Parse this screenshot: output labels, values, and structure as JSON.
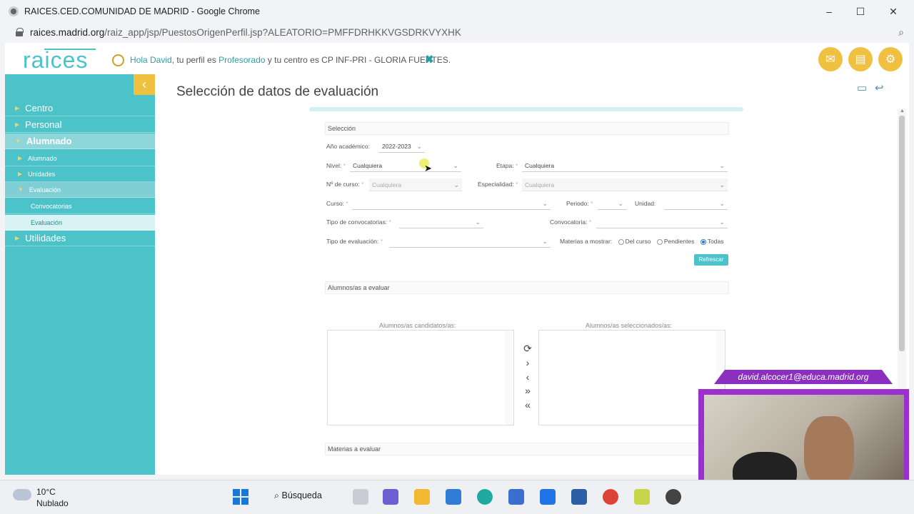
{
  "browser": {
    "window_title": "RAICES.CED.COMUNIDAD DE MADRID - Google Chrome",
    "url_domain": "raices.madrid.org",
    "url_path": "/raiz_app/jsp/PuestosOrigenPerfil.jsp?ALEATORIO=PMFFDRHKKVGSDRKVYXHK",
    "minimize": "–",
    "maximize": "☐",
    "close": "✕",
    "zoom_icon": "⌕"
  },
  "header": {
    "logo": "raices",
    "greeting_prefix": "Hola David",
    "greeting_mid1": ", tu perfil es ",
    "profile": "Profesorado",
    "greeting_mid2": " y tu centro es ",
    "centre": "CP INF-PRI - GLORIA FUERTES.",
    "close_mark": "✖",
    "icons": [
      "mail-icon",
      "documents-icon",
      "settings-icon"
    ]
  },
  "sidebar": {
    "collapse": "‹",
    "items": [
      {
        "label": "Centro"
      },
      {
        "label": "Personal"
      },
      {
        "label": "Alumnado"
      },
      {
        "label": "Alumnado"
      },
      {
        "label": "Unidades"
      },
      {
        "label": "Evaluación"
      },
      {
        "label": "Convocatorias"
      },
      {
        "label": "Evaluación"
      },
      {
        "label": "Utilidades"
      }
    ]
  },
  "main": {
    "title": "Selección de datos de evaluación",
    "selection_header": "Selección",
    "anio_label": "Año académico:",
    "anio_value": "2022-2023",
    "nivel_label": "Nivel:",
    "nivel_value": "Cualquiera",
    "etapa_label": "Etapa:",
    "etapa_value": "Cualquiera",
    "ncurso_label": "Nº de curso:",
    "ncurso_value": "Cualquiera",
    "especialidad_label": "Especialidad:",
    "especialidad_value": "Cualquiera",
    "curso_label": "Curso:",
    "periodo_label": "Periodo:",
    "unidad_label": "Unidad:",
    "tipo_conv_label": "Tipo de convocatorias:",
    "convocatoria_label": "Convocatoria:",
    "tipo_eval_label": "Tipo de evaluación:",
    "materias_label": "Materias a mostrar:",
    "radio_options": [
      "Del curso",
      "Pendientes",
      "Todas"
    ],
    "radio_selected": "Todas",
    "refresh_button": "Refrescar",
    "alumnos_header": "Alumnos/as a evaluar",
    "candidatos_label": "Alumnos/as candidatos/as:",
    "seleccionados_label": "Alumnos/as seleccionados/as:",
    "materias_header": "Materias a evaluar",
    "required_mark": "*"
  },
  "overlay": {
    "email": "david.alcocer1@educa.madrid.org"
  },
  "taskbar": {
    "temperature": "10°C",
    "weather": "Nublado",
    "search": "Búsqueda"
  }
}
